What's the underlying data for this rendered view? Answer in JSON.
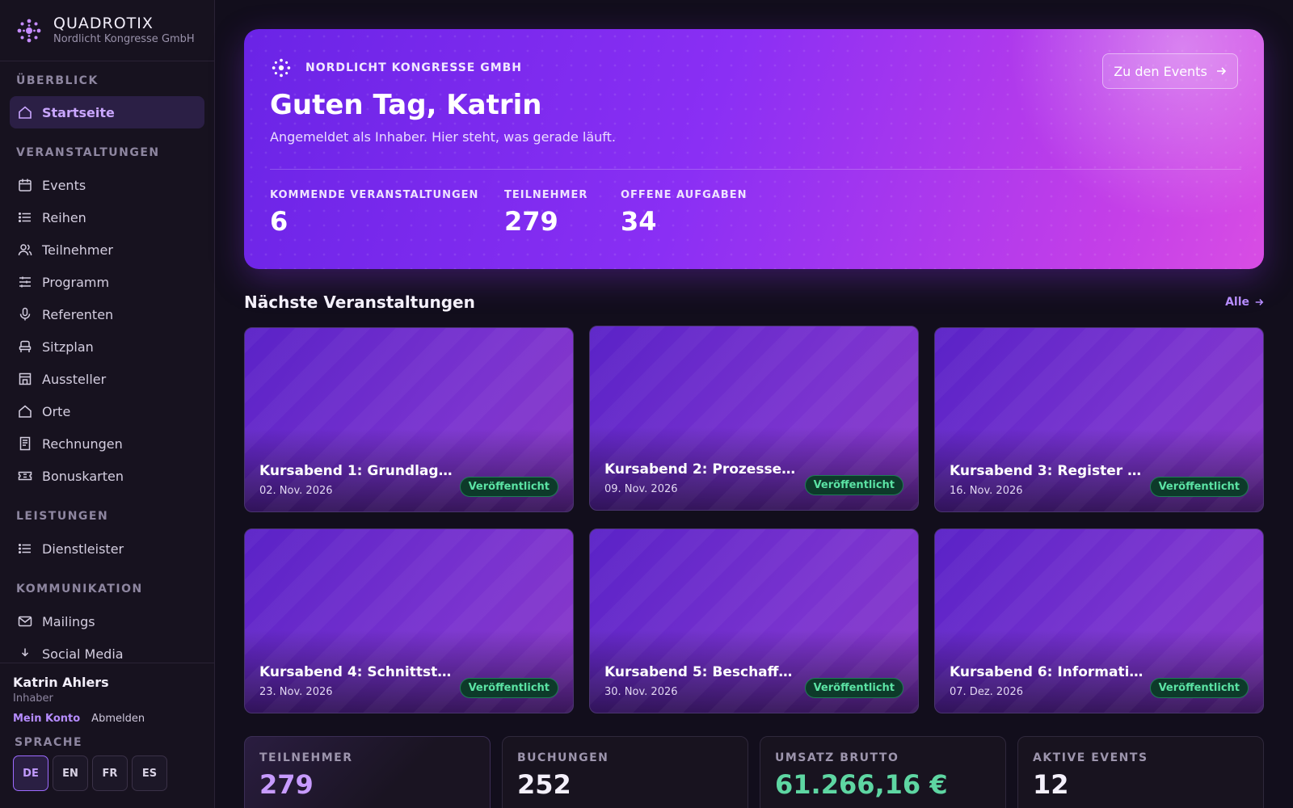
{
  "brand": {
    "name": "QUADROTIX",
    "org": "Nordlicht Kongresse GmbH"
  },
  "nav": {
    "sections": [
      {
        "title": "ÜBERBLICK",
        "items": [
          {
            "label": "Startseite",
            "icon": "home-icon",
            "active": true
          }
        ]
      },
      {
        "title": "VERANSTALTUNGEN",
        "items": [
          {
            "label": "Events",
            "icon": "calendar-icon"
          },
          {
            "label": "Reihen",
            "icon": "list-icon"
          },
          {
            "label": "Teilnehmer",
            "icon": "users-icon"
          },
          {
            "label": "Programm",
            "icon": "sliders-icon"
          },
          {
            "label": "Referenten",
            "icon": "microphone-icon"
          },
          {
            "label": "Sitzplan",
            "icon": "seat-icon"
          },
          {
            "label": "Aussteller",
            "icon": "store-icon"
          },
          {
            "label": "Orte",
            "icon": "house-icon"
          },
          {
            "label": "Rechnungen",
            "icon": "receipt-icon"
          },
          {
            "label": "Bonuskarten",
            "icon": "ticket-icon"
          }
        ]
      },
      {
        "title": "LEISTUNGEN",
        "items": [
          {
            "label": "Dienstleister",
            "icon": "list-icon"
          }
        ]
      },
      {
        "title": "KOMMUNIKATION",
        "items": [
          {
            "label": "Mailings",
            "icon": "mail-icon"
          },
          {
            "label": "Social Media",
            "icon": "share-icon"
          }
        ]
      }
    ]
  },
  "user": {
    "name": "Katrin Ahlers",
    "role": "Inhaber",
    "account_link": "Mein Konto",
    "logout_link": "Abmelden"
  },
  "language": {
    "label": "SPRACHE",
    "options": [
      "DE",
      "EN",
      "FR",
      "ES"
    ],
    "selected": "DE"
  },
  "hero": {
    "org": "NORDLICHT KONGRESSE GMBH",
    "title": "Guten Tag, Katrin",
    "subtitle": "Angemeldet als Inhaber. Hier steht, was gerade läuft.",
    "button_label": "Zu den Events",
    "stats": [
      {
        "label": "KOMMENDE VERANSTALTUNGEN",
        "value": "6"
      },
      {
        "label": "TEILNEHMER",
        "value": "279"
      },
      {
        "label": "OFFENE AUFGABEN",
        "value": "34"
      }
    ]
  },
  "events_section": {
    "title": "Nächste Veranstaltungen",
    "link": "Alle",
    "events": [
      {
        "title": "Kursabend 1: Grundlag…",
        "date": "02. Nov. 2026",
        "status": "Veröffentlicht"
      },
      {
        "title": "Kursabend 2: Prozesse …",
        "date": "09. Nov. 2026",
        "status": "Veröffentlicht"
      },
      {
        "title": "Kursabend 3: Register …",
        "date": "16. Nov. 2026",
        "status": "Veröffentlicht"
      },
      {
        "title": "Kursabend 4: Schnittst…",
        "date": "23. Nov. 2026",
        "status": "Veröffentlicht"
      },
      {
        "title": "Kursabend 5: Beschaffu…",
        "date": "30. Nov. 2026",
        "status": "Veröffentlicht"
      },
      {
        "title": "Kursabend 6: Informati…",
        "date": "07. Dez. 2026",
        "status": "Veröffentlicht"
      }
    ]
  },
  "kpis": [
    {
      "label": "TEILNEHMER",
      "value": "279",
      "color": "#c79bff"
    },
    {
      "label": "BUCHUNGEN",
      "value": "252",
      "color": "#f4f0fb"
    },
    {
      "label": "UMSATZ BRUTTO",
      "value": "61.266,16 €",
      "color": "#5ed6a2"
    },
    {
      "label": "AKTIVE EVENTS",
      "value": "12",
      "color": "#f4f0fb"
    }
  ],
  "colors": {
    "accent": "#9d6bff",
    "success": "#5be3a4",
    "background": "#120e1c"
  }
}
